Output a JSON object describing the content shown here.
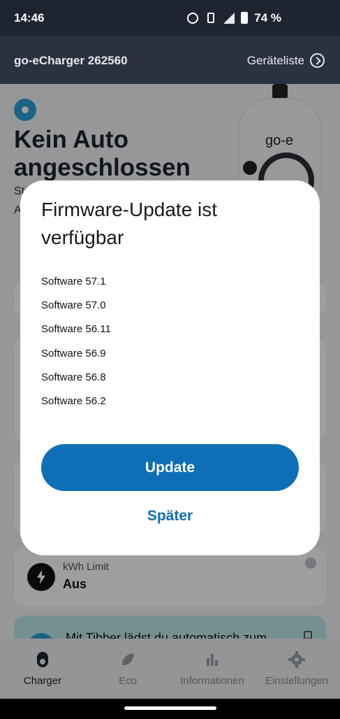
{
  "status_bar": {
    "time": "14:46",
    "battery_percent": "74 %",
    "icons": [
      "alarm-icon",
      "vibrate-icon",
      "signal-icon",
      "battery-icon"
    ]
  },
  "header": {
    "device_name": "go-eCharger 262560",
    "device_list_label": "Geräteliste"
  },
  "background_page": {
    "title": "Kein Auto angeschlossen",
    "subtitle_line1": "St",
    "subtitle_line2": "A",
    "charger_logo": "go-e",
    "kwh_limit": {
      "label": "kWh Limit",
      "value": "Aus"
    },
    "tibber_text": "Mit Tibber lädst du automatisch zum"
  },
  "dialog": {
    "title": "Firmware-Update ist verfügbar",
    "versions": [
      "Software 57.1",
      "Software 57.0",
      "Software 56.11",
      "Software 56.9",
      "Software 56.8",
      "Software 56.2"
    ],
    "primary_label": "Update",
    "secondary_label": "Später"
  },
  "bottom_nav": {
    "items": [
      {
        "label": "Charger",
        "icon": "charger-icon",
        "active": true
      },
      {
        "label": "Eco",
        "icon": "leaf-icon",
        "active": false
      },
      {
        "label": "Informationen",
        "icon": "bar-chart-icon",
        "active": false
      },
      {
        "label": "Einstellungen",
        "icon": "gear-icon",
        "active": false
      }
    ]
  },
  "colors": {
    "accent": "#0f6fb6",
    "header_bg": "#2a3241",
    "status_blue": "#2aa2d9"
  }
}
